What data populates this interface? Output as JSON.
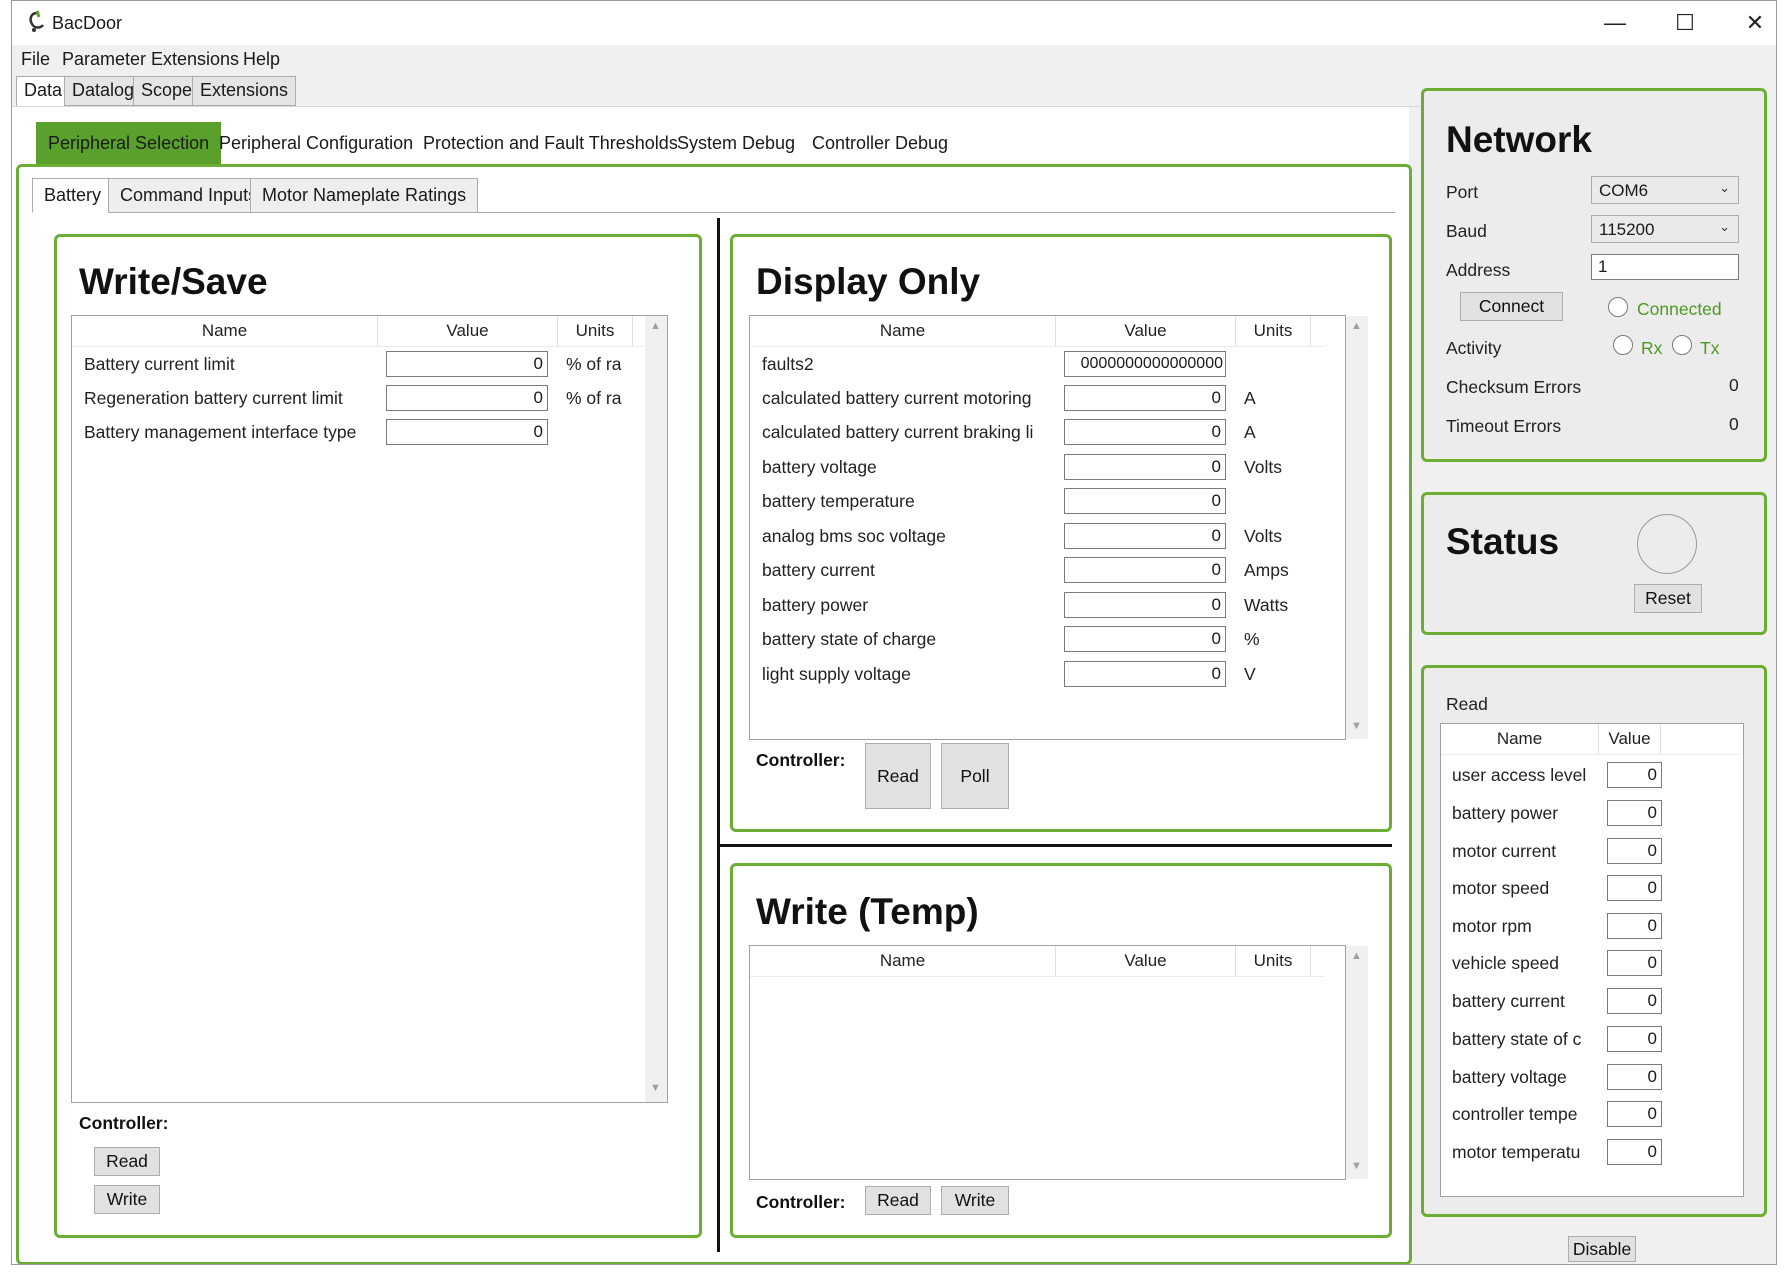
{
  "window": {
    "title": "BacDoor",
    "controls": {
      "minimize": "—",
      "maximize": "☐",
      "close": "✕"
    }
  },
  "menu": [
    "File",
    "Parameter",
    "Extensions",
    "Help"
  ],
  "main_tabs": [
    "Data",
    "Datalog",
    "Scope",
    "Extensions"
  ],
  "sub_tabs": [
    "Peripheral Selection",
    "Peripheral Configuration",
    "Protection and Fault Thresholds",
    "System Debug",
    "Controller Debug"
  ],
  "inner_tabs": [
    "Battery",
    "Command Inputs",
    "Motor Nameplate Ratings"
  ],
  "write_save": {
    "title": "Write/Save",
    "headers": [
      "Name",
      "Value",
      "Units"
    ],
    "rows": [
      {
        "name": "Battery current limit",
        "value": "0",
        "unit": "% of ra"
      },
      {
        "name": "Regeneration battery current limit",
        "value": "0",
        "unit": "% of ra"
      },
      {
        "name": "Battery management interface type",
        "value": "0",
        "unit": ""
      }
    ],
    "controller_label": "Controller:",
    "read_label": "Read",
    "write_label": "Write"
  },
  "display_only": {
    "title": "Display Only",
    "headers": [
      "Name",
      "Value",
      "Units"
    ],
    "rows": [
      {
        "name": "faults2",
        "value": "0000000000000000",
        "unit": ""
      },
      {
        "name": "calculated battery current motoring",
        "value": "0",
        "unit": "A"
      },
      {
        "name": "calculated battery current braking li",
        "value": "0",
        "unit": "A"
      },
      {
        "name": "battery voltage",
        "value": "0",
        "unit": "Volts"
      },
      {
        "name": "battery temperature",
        "value": "0",
        "unit": ""
      },
      {
        "name": "analog bms soc voltage",
        "value": "0",
        "unit": "Volts"
      },
      {
        "name": "battery current",
        "value": "0",
        "unit": "Amps"
      },
      {
        "name": "battery power",
        "value": "0",
        "unit": "Watts"
      },
      {
        "name": "battery state of charge",
        "value": "0",
        "unit": "%"
      },
      {
        "name": "light supply voltage",
        "value": "0",
        "unit": "V"
      }
    ],
    "controller_label": "Controller:",
    "read_label": "Read",
    "poll_label": "Poll"
  },
  "write_temp": {
    "title": "Write (Temp)",
    "headers": [
      "Name",
      "Value",
      "Units"
    ],
    "controller_label": "Controller:",
    "read_label": "Read",
    "write_label": "Write"
  },
  "network": {
    "title": "Network",
    "port_label": "Port",
    "port_value": "COM6",
    "baud_label": "Baud",
    "baud_value": "115200",
    "address_label": "Address",
    "address_value": "1",
    "connect_label": "Connect",
    "connected_label": "Connected",
    "activity_label": "Activity",
    "rx_label": "Rx",
    "tx_label": "Tx",
    "checksum_label": "Checksum Errors",
    "checksum_value": "0",
    "timeout_label": "Timeout Errors",
    "timeout_value": "0"
  },
  "status": {
    "title": "Status",
    "reset_label": "Reset"
  },
  "read_panel": {
    "title": "Read",
    "headers": [
      "Name",
      "Value"
    ],
    "rows": [
      {
        "name": "user access level",
        "value": "0"
      },
      {
        "name": "battery power",
        "value": "0"
      },
      {
        "name": "motor current",
        "value": "0"
      },
      {
        "name": "motor speed",
        "value": "0"
      },
      {
        "name": "motor rpm",
        "value": "0"
      },
      {
        "name": "vehicle speed",
        "value": "0"
      },
      {
        "name": "battery current",
        "value": "0"
      },
      {
        "name": "battery state of c",
        "value": "0"
      },
      {
        "name": "battery voltage",
        "value": "0"
      },
      {
        "name": "controller tempe",
        "value": "0"
      },
      {
        "name": "motor temperatu",
        "value": "0"
      }
    ],
    "disable_label": "Disable"
  },
  "colors": {
    "accent_green": "#6cae34",
    "active_tab": "#5aa02c",
    "connected_text": "#4d9a22"
  }
}
